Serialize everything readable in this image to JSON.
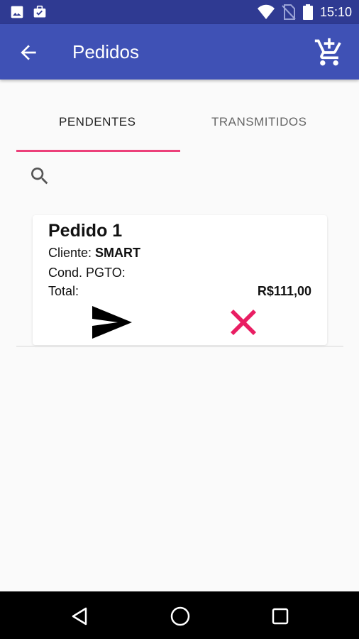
{
  "status_bar": {
    "time": "15:10",
    "icons": [
      "image-icon",
      "briefcase-check-icon",
      "wifi-icon",
      "no-sim-icon",
      "battery-icon"
    ]
  },
  "app_bar": {
    "title": "Pedidos",
    "back_icon": "arrow-back-icon",
    "cart_icon": "cart-add-icon",
    "background_color": "#3f51b5",
    "status_color": "#2f3a92"
  },
  "tabs": [
    {
      "label": "PENDENTES",
      "active": true
    },
    {
      "label": "TRANSMITIDOS",
      "active": false
    }
  ],
  "tab_indicator_color": "#ec407a",
  "search": {
    "icon": "search-icon"
  },
  "order": {
    "title": "Pedido 1",
    "cliente_label": "Cliente:",
    "cliente_value": "SMART",
    "cond_label": "Cond. PGTO:",
    "total_label": "Total:",
    "total_value": "R$111,00",
    "send_icon": "send-icon",
    "delete_icon": "close-icon",
    "delete_color": "#e91e63"
  },
  "nav_bar": {
    "icons": [
      "nav-back-icon",
      "nav-home-icon",
      "nav-recents-icon"
    ]
  }
}
